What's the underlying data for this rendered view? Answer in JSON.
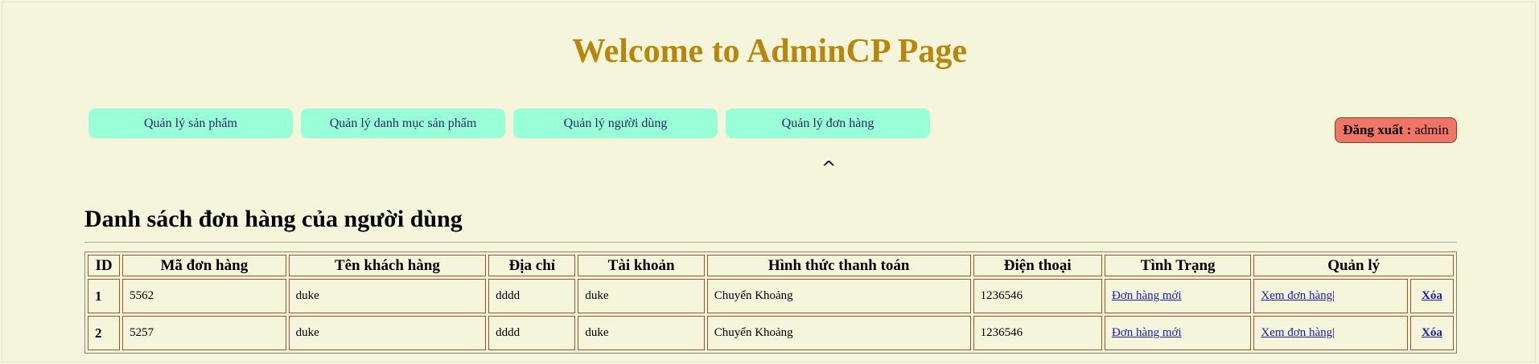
{
  "header": {
    "title": "Welcome to AdminCP Page"
  },
  "nav": {
    "items": [
      {
        "label": "Quản lý sản phẩm"
      },
      {
        "label": "Quản lý danh mục sản phẩm"
      },
      {
        "label": "Quản lý người dùng"
      },
      {
        "label": "Quản lý đơn hàng"
      }
    ]
  },
  "logout": {
    "label": "Đăng xuất :",
    "user": "admin"
  },
  "caret": "^",
  "section": {
    "title": "Danh sách đơn hàng của người dùng"
  },
  "table": {
    "headers": [
      "ID",
      "Mã đơn hàng",
      "Tên khách hàng",
      "Địa chỉ",
      "Tài khoản",
      "Hình thức thanh toán",
      "Điện thoại",
      "Tình Trạng",
      "Quản lý"
    ],
    "rows": [
      {
        "id": "1",
        "code": "5562",
        "customer": "duke",
        "address": "dddd",
        "account": "duke",
        "payment": "Chuyển Khoảng",
        "phone": "1236546",
        "status": "Đơn hàng mới",
        "view": "Xem đơn hàng|",
        "delete": "Xóa"
      },
      {
        "id": "2",
        "code": "5257",
        "customer": "duke",
        "address": "dddd",
        "account": "duke",
        "payment": "Chuyển Khoảng",
        "phone": "1236546",
        "status": "Đơn hàng mới",
        "view": "Xem đơn hàng|",
        "delete": "Xóa"
      }
    ]
  },
  "colors": {
    "background": "#f5f5dc",
    "title": "#b8860b",
    "nav_button": "#99ffd6",
    "logout_button": "#f07566",
    "table_border": "#a0522d"
  }
}
